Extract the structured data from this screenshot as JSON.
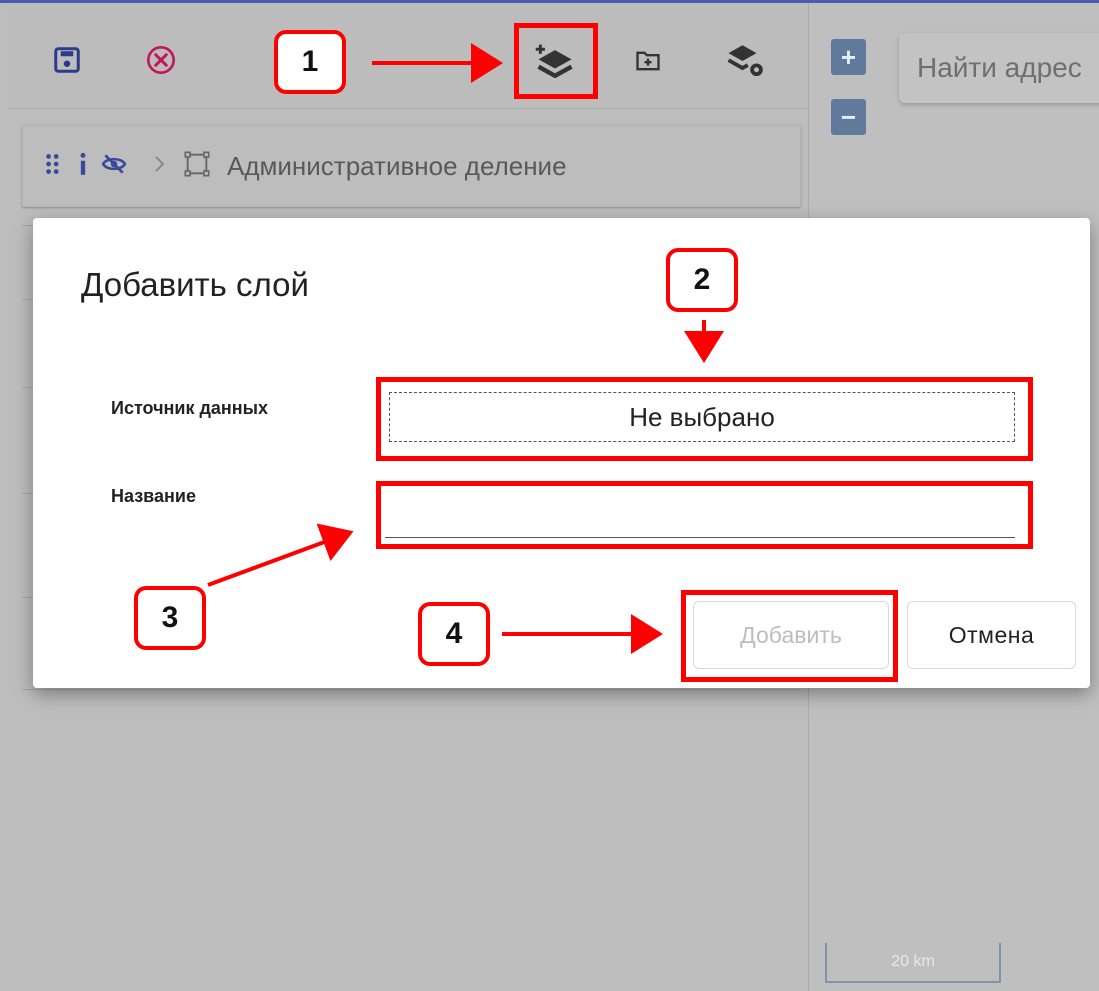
{
  "toolbar": {
    "buttons": [
      {
        "name": "save-icon"
      },
      {
        "name": "close-circle-icon"
      },
      {
        "name": "add-layer-icon"
      },
      {
        "name": "add-folder-icon"
      },
      {
        "name": "layer-settings-icon"
      }
    ]
  },
  "layer_tree": {
    "root_title": "Административное деление"
  },
  "map": {
    "zoom_in": "+",
    "zoom_out": "−",
    "search_placeholder": "Найти адрес",
    "scale_label": "20 km"
  },
  "dialog": {
    "title": "Добавить слой",
    "source_label": "Источник данных",
    "source_value": "Не выбрано",
    "name_label": "Название",
    "name_value": "",
    "add_button": "Добавить",
    "cancel_button": "Отмена"
  },
  "annotations": {
    "badges": [
      "1",
      "2",
      "3",
      "4"
    ],
    "color": "#ff0000"
  },
  "colors": {
    "save_icon": "#2a3a8c",
    "close_icon": "#c2185b",
    "icon_dark": "#333333",
    "overlay_gray": "#bdbdbd",
    "map_control": "#5f7a9a"
  }
}
